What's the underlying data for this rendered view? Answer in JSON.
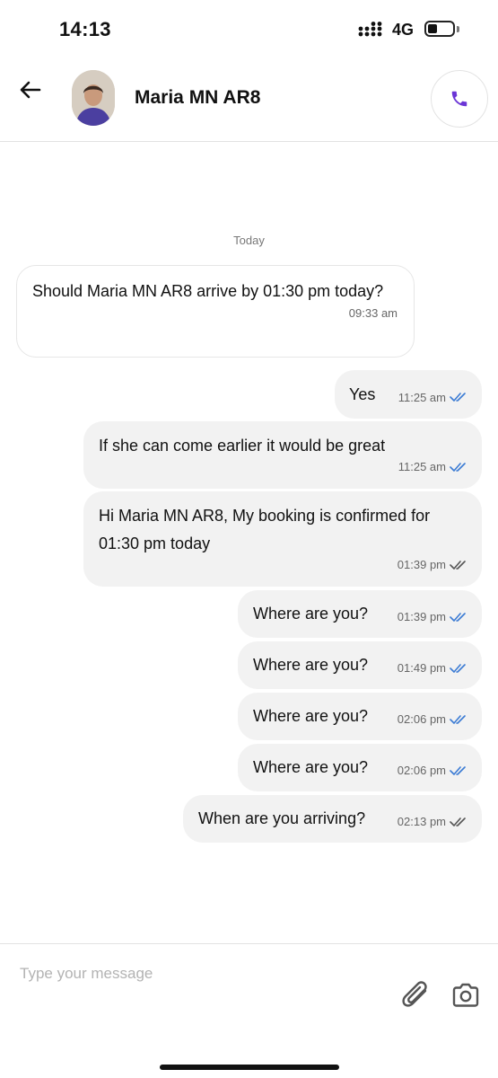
{
  "status_bar": {
    "time": "14:13",
    "network": "4G",
    "icons": [
      "signal-icon",
      "battery-icon"
    ]
  },
  "header": {
    "contact_name": "Maria MN AR8",
    "icons": [
      "back-arrow-icon",
      "phone-icon"
    ],
    "accent_color": "#6b35d6"
  },
  "conversation": {
    "date_label": "Today",
    "messages": [
      {
        "direction": "incoming",
        "text": "Should Maria MN AR8 arrive by 01:30 pm today?",
        "time": "09:33 am",
        "status": ""
      },
      {
        "direction": "outgoing",
        "text": "Yes",
        "time": "11:25 am",
        "status": "read"
      },
      {
        "direction": "outgoing",
        "text": "If she can come earlier it would be great",
        "time": "11:25 am",
        "status": "read"
      },
      {
        "direction": "outgoing",
        "text": "Hi Maria MN AR8, My booking is confirmed for 01:30 pm today",
        "time": "01:39 pm",
        "status": "delivered"
      },
      {
        "direction": "outgoing",
        "text": "Where are you?",
        "time": "01:39 pm",
        "status": "read"
      },
      {
        "direction": "outgoing",
        "text": "Where are you?",
        "time": "01:49 pm",
        "status": "read"
      },
      {
        "direction": "outgoing",
        "text": "Where are you?",
        "time": "02:06 pm",
        "status": "read"
      },
      {
        "direction": "outgoing",
        "text": "Where are you?",
        "time": "02:06 pm",
        "status": "read"
      },
      {
        "direction": "outgoing",
        "text": "When are you arriving?",
        "time": "02:13 pm",
        "status": "delivered"
      }
    ],
    "colors": {
      "read_tick": "#3b7bd4",
      "delivered_tick": "#555555"
    }
  },
  "composer": {
    "placeholder": "Type your message",
    "value": "",
    "icons": [
      "paperclip-icon",
      "camera-icon"
    ]
  }
}
